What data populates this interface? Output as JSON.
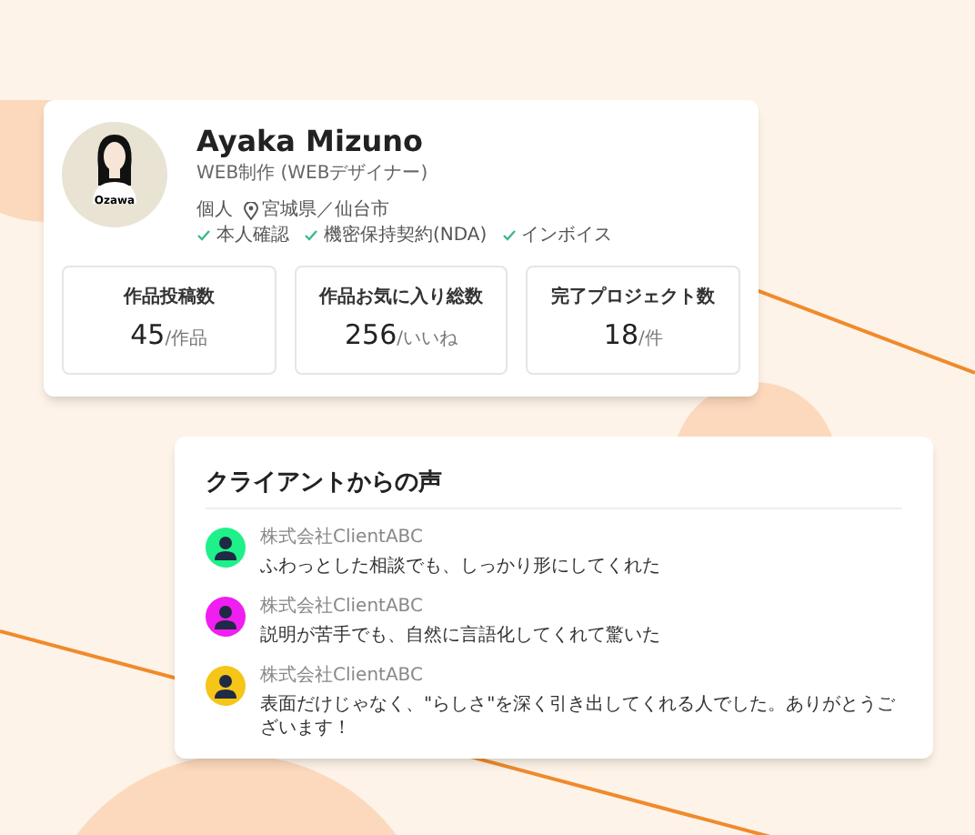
{
  "profile": {
    "avatar_label": "Ozawa",
    "name": "Ayaka Mizuno",
    "role": "WEB制作 (WEBデザイナー)",
    "type": "個人",
    "location": "宮城県／仙台市",
    "verifications": [
      "本人確認",
      "機密保持契約(NDA)",
      "インボイス"
    ],
    "stats": [
      {
        "label": "作品投稿数",
        "value": "45",
        "unit": "/作品"
      },
      {
        "label": "作品お気に入り総数",
        "value": "256",
        "unit": "/いいね"
      },
      {
        "label": "完了プロジェクト数",
        "value": "18",
        "unit": "/件"
      }
    ]
  },
  "testimonials": {
    "title": "クライアントからの声",
    "items": [
      {
        "client": "株式会社ClientABC",
        "comment": "ふわっとした相談でも、しっかり形にしてくれた",
        "color": "#1ef08a"
      },
      {
        "client": "株式会社ClientABC",
        "comment": "説明が苦手でも、自然に言語化してくれて驚いた",
        "color": "#f01ef0"
      },
      {
        "client": "株式会社ClientABC",
        "comment": "表面だけじゃなく、\"らしさ\"を深く引き出してくれる人でした。ありがとうございます！",
        "color": "#f5c518"
      }
    ]
  }
}
